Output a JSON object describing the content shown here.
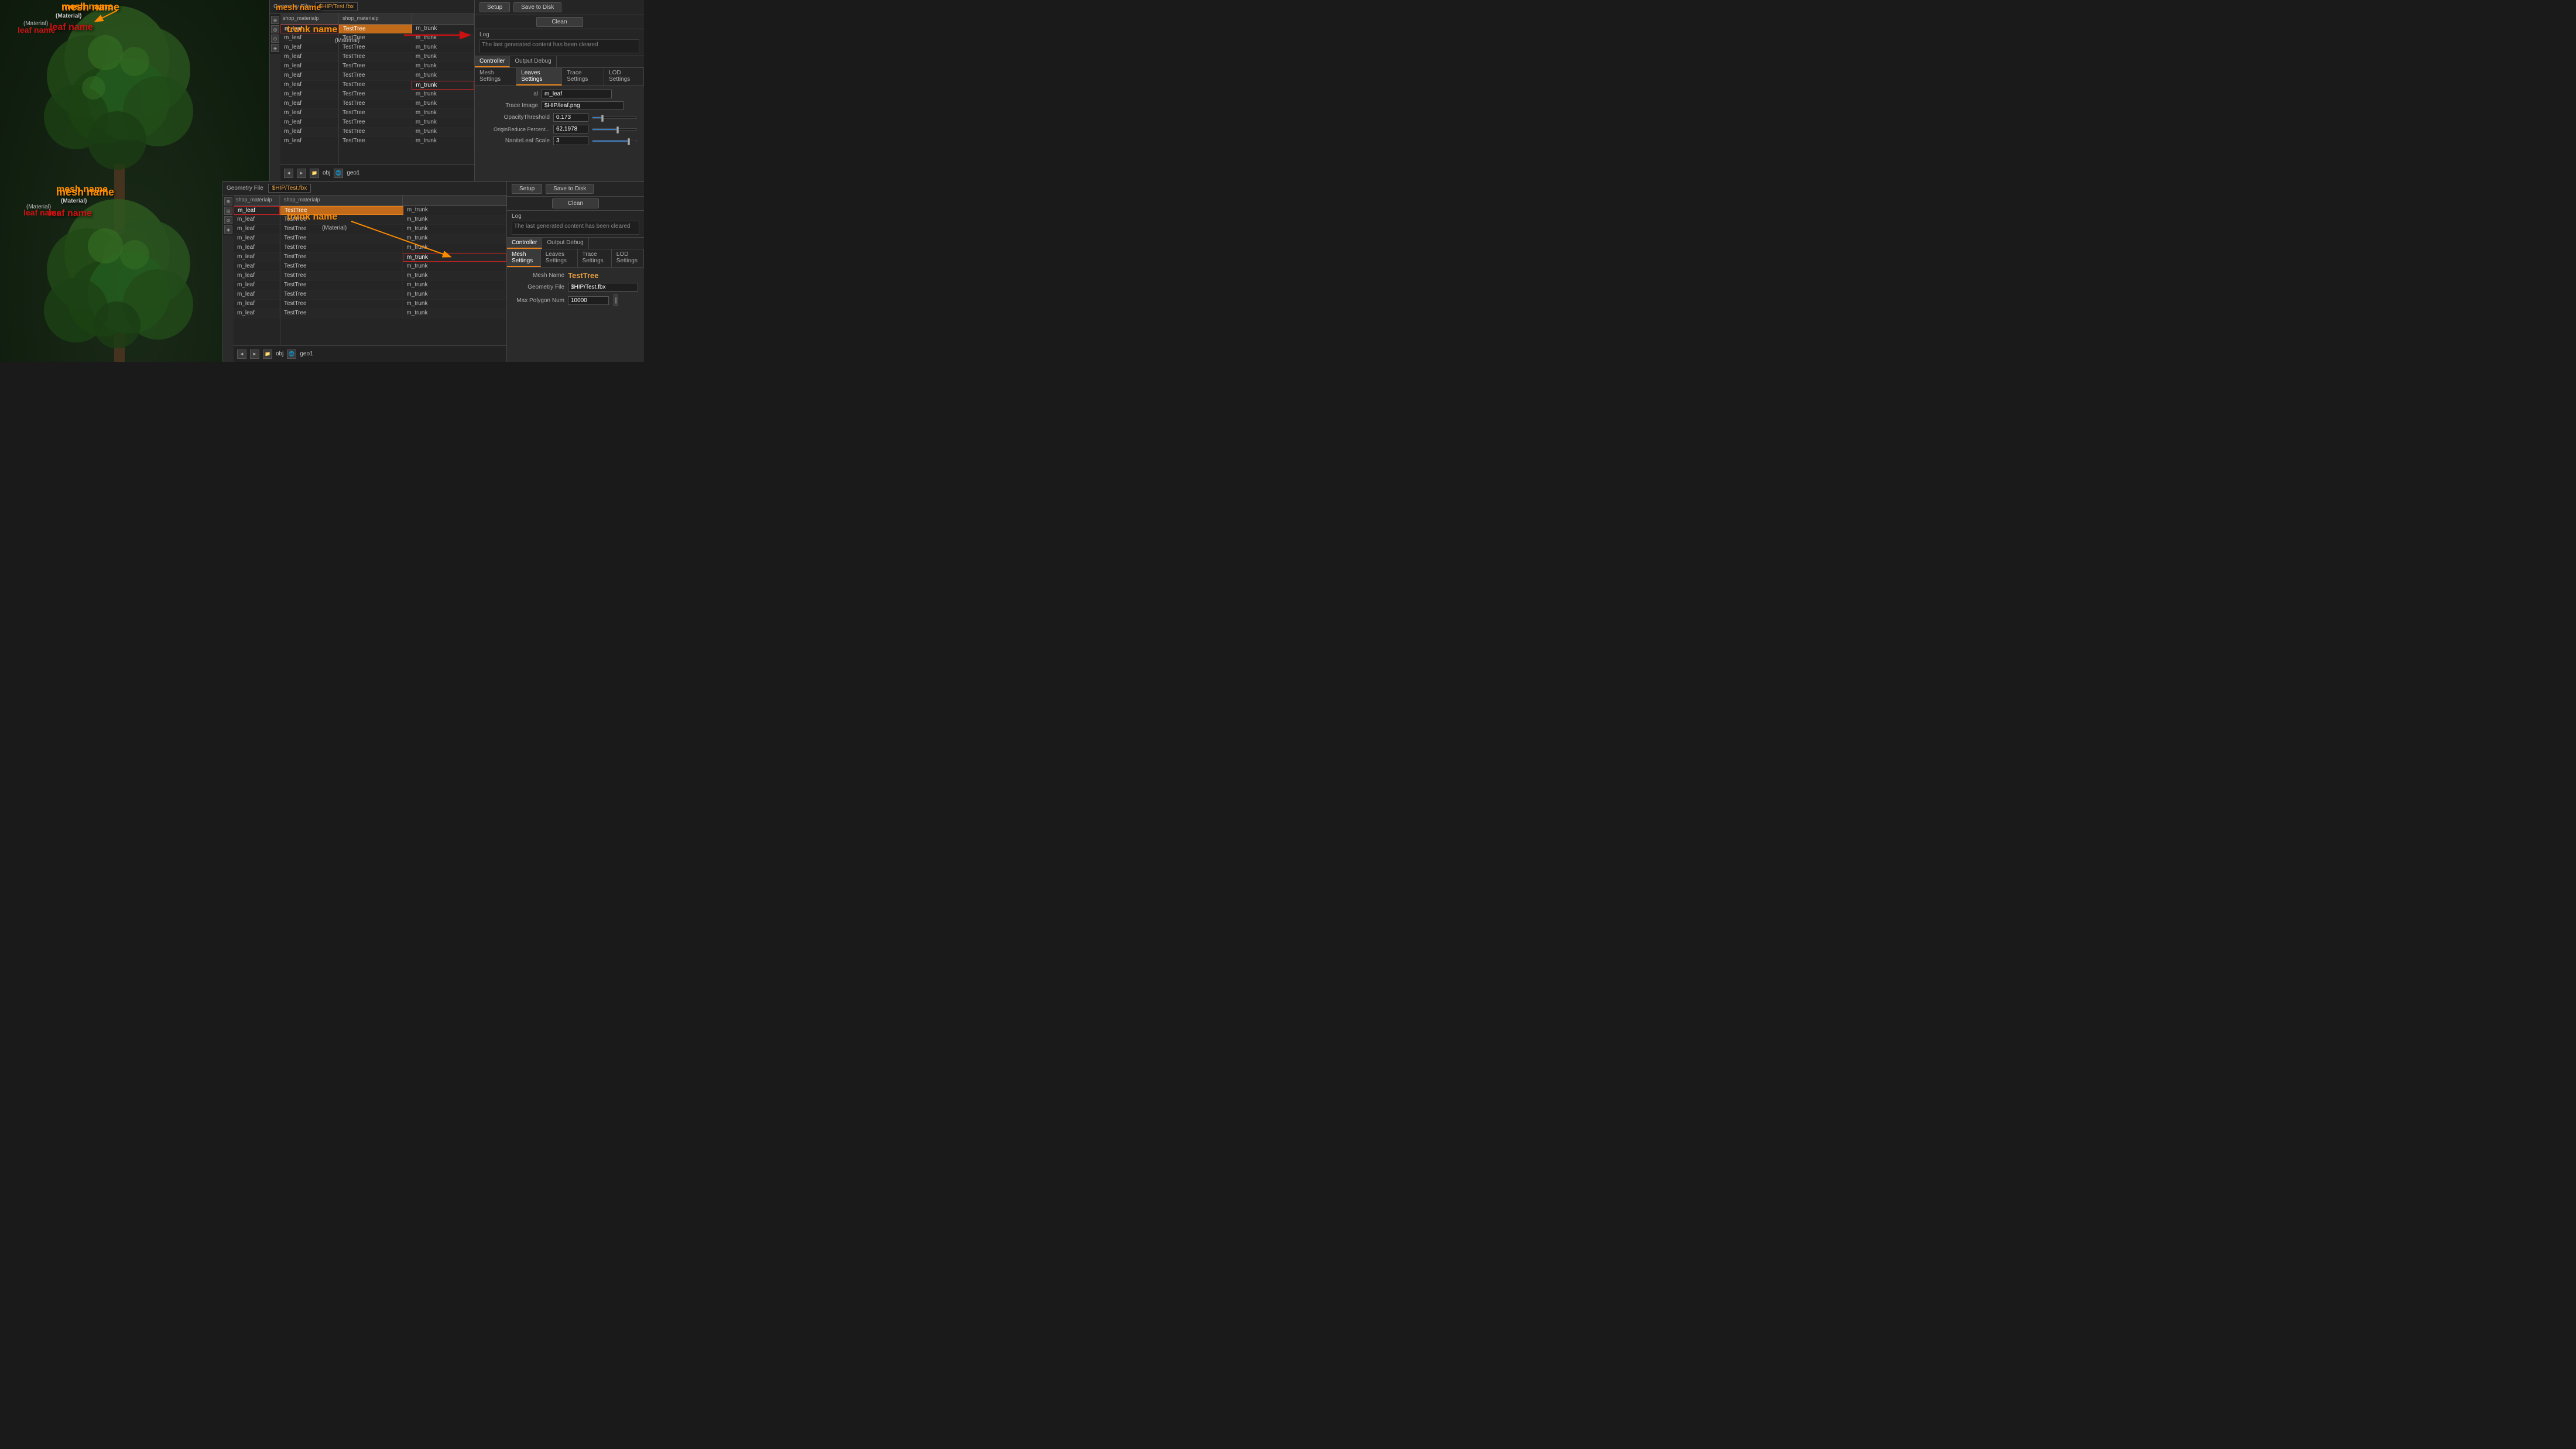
{
  "top_panel": {
    "geometry_file_label": "Geometry File",
    "geometry_file_value": "$HIP/Test.fbx",
    "setup_btn": "Setup",
    "save_to_disk_btn": "Save to Disk",
    "clean_btn": "Clean",
    "log_label": "Log",
    "log_text": "The last generated content has been cleared",
    "tabs": [
      "Controller",
      "Output Debug"
    ],
    "settings_tabs": [
      "Mesh Settings",
      "Leaves Settings",
      "Trace Settings",
      "LOD Settings"
    ],
    "active_settings_tab": "Leaves Settings",
    "fields": {
      "material_label": "al",
      "material_value": "m_leaf",
      "trace_image_label": "Trace Image",
      "trace_image_value": "$HIP/leaf.png",
      "opacity_label": "OpacityThreshold",
      "opacity_value": "0.173",
      "opacity_slider_pct": 20,
      "origin_label": "OriginReduce Percent...",
      "origin_value": "62.1978",
      "origin_slider_pct": 55,
      "nanite_label": "NaniteLeaf Scale",
      "nanite_value": "3",
      "nanite_slider_pct": 80
    }
  },
  "bottom_panel": {
    "geometry_file_label": "Geometry File",
    "geometry_file_value": "$HIP/Test.fbx",
    "setup_btn": "Setup",
    "save_to_disk_btn": "Save to Disk",
    "clean_btn": "Clean",
    "log_label": "Log",
    "log_text": "The last generated content has been cleared",
    "tabs": [
      "Controller",
      "Output Debug"
    ],
    "settings_tabs": [
      "Mesh Settings",
      "Leaves Settings",
      "Trace Settings",
      "LOD Settings"
    ],
    "active_settings_tab": "Mesh Settings",
    "fields": {
      "mesh_name_label": "Mesh Name",
      "mesh_name_value": "TestTree",
      "geometry_label": "Geometry File",
      "geometry_value": "$HIP/Test.fbx",
      "max_poly_label": "Max Polygon Num",
      "max_poly_value": "10000"
    }
  },
  "table_top": {
    "headers": [
      "shop_materialp",
      ""
    ],
    "rows": [
      {
        "col1": "TestTree",
        "col2": "m_trunk",
        "highlight1": true,
        "highlight2": false
      },
      {
        "col1": "TestTree",
        "col2": "m_trunk",
        "highlight1": false,
        "highlight2": false
      },
      {
        "col1": "TestTree",
        "col2": "m_trunk",
        "highlight1": false,
        "highlight2": false
      },
      {
        "col1": "TestTree",
        "col2": "m_trunk",
        "highlight1": false,
        "highlight2": false
      },
      {
        "col1": "TestTree",
        "col2": "m_trunk",
        "highlight1": false,
        "highlight2": false
      },
      {
        "col1": "TestTree",
        "col2": "m_trunk",
        "highlight1": false,
        "highlight2": false
      },
      {
        "col1": "TestTree",
        "col2": "m_trunk",
        "highlight1": false,
        "highlight2": true
      },
      {
        "col1": "TestTree",
        "col2": "m_trunk",
        "highlight1": false,
        "highlight2": false
      },
      {
        "col1": "TestTree",
        "col2": "m_trunk",
        "highlight1": false,
        "highlight2": false
      },
      {
        "col1": "TestTree",
        "col2": "m_trunk",
        "highlight1": false,
        "highlight2": false
      },
      {
        "col1": "TestTree",
        "col2": "m_trunk",
        "highlight1": false,
        "highlight2": false
      },
      {
        "col1": "TestTree",
        "col2": "m_trunk",
        "highlight1": false,
        "highlight2": false
      },
      {
        "col1": "TestTree",
        "col2": "m_trunk",
        "highlight1": false,
        "highlight2": false
      }
    ],
    "left_col_header": "shop_materialp",
    "left_rows": [
      "m_leaf",
      "m_leaf",
      "m_leaf",
      "m_leaf",
      "m_leaf",
      "m_leaf",
      "m_leaf",
      "m_leaf",
      "m_leaf",
      "m_leaf",
      "m_leaf",
      "m_leaf",
      "m_leaf"
    ]
  },
  "table_bottom": {
    "left_col_header": "shop_materialp",
    "right_col_header": "",
    "rows": [
      {
        "col1": "TestTree",
        "col2": "m_trunk",
        "h1": true,
        "h2": false
      },
      {
        "col1": "TestTree",
        "col2": "m_trunk",
        "h1": false,
        "h2": false
      },
      {
        "col1": "TestTree",
        "col2": "m_trunk",
        "h1": false,
        "h2": false
      },
      {
        "col1": "TestTree",
        "col2": "m_trunk",
        "h1": false,
        "h2": false
      },
      {
        "col1": "TestTree",
        "col2": "m_trunk",
        "h1": false,
        "h2": false
      },
      {
        "col1": "TestTree",
        "col2": "m_trunk",
        "h1": false,
        "h2": true
      },
      {
        "col1": "TestTree",
        "col2": "m_trunk",
        "h1": false,
        "h2": false
      },
      {
        "col1": "TestTree",
        "col2": "m_trunk",
        "h1": false,
        "h2": false
      },
      {
        "col1": "TestTree",
        "col2": "m_trunk",
        "h1": false,
        "h2": false
      },
      {
        "col1": "TestTree",
        "col2": "m_trunk",
        "h1": false,
        "h2": false
      },
      {
        "col1": "TestTree",
        "col2": "m_trunk",
        "h1": false,
        "h2": false
      },
      {
        "col1": "TestTree",
        "col2": "m_trunk",
        "h1": false,
        "h2": false
      }
    ],
    "left_rows": [
      "m_leaf",
      "m_leaf",
      "m_leaf",
      "m_leaf",
      "m_leaf",
      "m_leaf",
      "m_leaf",
      "m_leaf",
      "m_leaf",
      "m_leaf",
      "m_leaf",
      "m_leaf"
    ]
  },
  "annotations": {
    "mesh_name_top": "mesh name",
    "leaf_name_top": "leaf name",
    "trunk_name_top": "trunk name",
    "mesh_name_bottom": "mesh name",
    "leaf_name_bottom": "leaf name",
    "trunk_name_bottom": "trunk name",
    "material_top": "(Material)",
    "material_bottom": "(Material)",
    "material_left_top": "(Material)",
    "material_left_bottom": "(Material)"
  },
  "bottom_bar": {
    "obj_label": "obj",
    "geo_label": "geo1"
  }
}
